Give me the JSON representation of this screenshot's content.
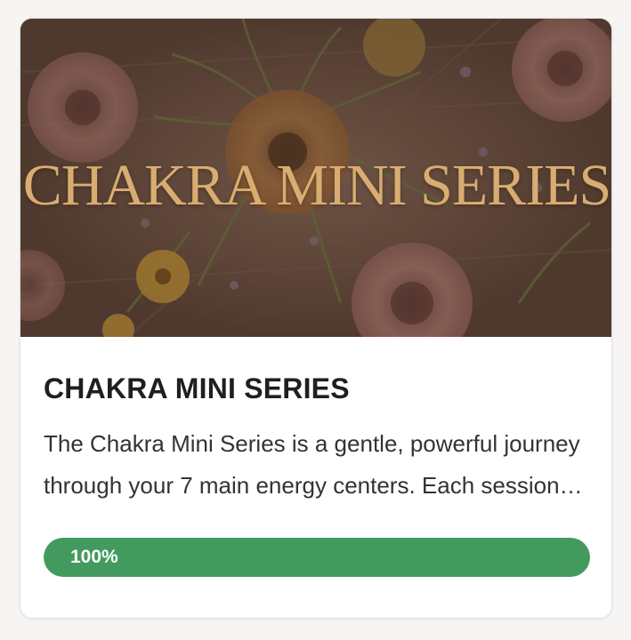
{
  "card": {
    "banner_text": "CHAKRA MINI SERIES",
    "title": "CHAKRA MINI SERIES",
    "description": "The Chakra Mini Series is a gentle, powerful journey through your 7 main energy centers. Each session invites you to reconnect with your body, breath and inner balance.",
    "progress": {
      "value": 1.0,
      "label": "100%"
    }
  },
  "colors": {
    "banner_text": "#d9ad72",
    "progress_fill": "#439a5f",
    "progress_track": "#e6e6e6",
    "title": "#1f1f1f",
    "body_text": "#333333"
  }
}
